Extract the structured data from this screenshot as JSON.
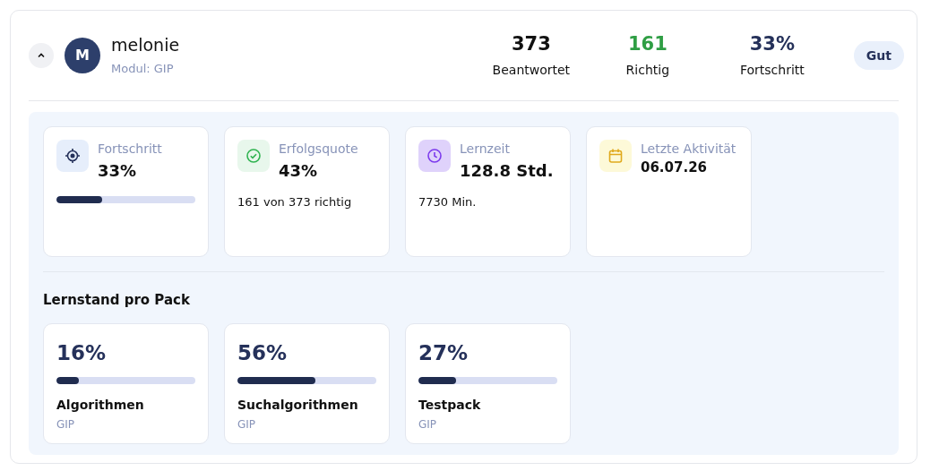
{
  "user": {
    "expanded": true,
    "initial": "M",
    "name": "melonie",
    "module": "Modul: GIP"
  },
  "summary": [
    {
      "value": "373",
      "label": "Beantwortet",
      "kind": "plain"
    },
    {
      "value": "161",
      "label": "Richtig",
      "kind": "correct"
    },
    {
      "value": "33%",
      "label": "Fortschritt",
      "kind": "progress"
    }
  ],
  "badge": "Gut",
  "stat_cards": [
    {
      "kind": "progress",
      "title": "Fortschritt",
      "value": "33%",
      "level": 0.33
    },
    {
      "kind": "ratio",
      "title": "Erfolgsquote",
      "value": "43%",
      "note": "161 von 373 richtig"
    },
    {
      "kind": "time",
      "title": "Lernzeit",
      "value": "128.8 Std.",
      "note": "7730 Min."
    },
    {
      "kind": "date",
      "title": "Letzte Aktivität",
      "value": "06.07.26"
    }
  ],
  "packs_heading": "Lernstand pro Pack",
  "packs": [
    {
      "percent": "16%",
      "level": 0.16,
      "name": "Algorithmen",
      "module": "GIP"
    },
    {
      "percent": "56%",
      "level": 0.56,
      "name": "Suchalgorithmen",
      "module": "GIP"
    },
    {
      "percent": "27%",
      "level": 0.27,
      "name": "Testpack",
      "module": "GIP"
    }
  ]
}
